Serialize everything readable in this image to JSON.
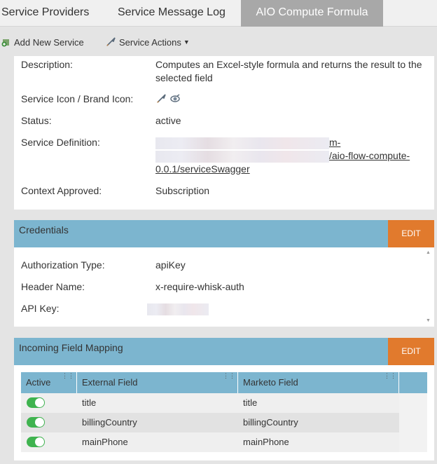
{
  "tabs": [
    {
      "label": "Service Providers",
      "active": false
    },
    {
      "label": "Service Message Log",
      "active": false
    },
    {
      "label": "AIO Compute Formula",
      "active": true
    }
  ],
  "toolbar": {
    "add_label": "Add New Service",
    "actions_label": "Service Actions",
    "add_icon": "add-service-icon",
    "actions_icon": "rocket-icon"
  },
  "details": {
    "description_label": "Description:",
    "description_value": "Computes an Excel-style formula and returns the result to the selected field",
    "icon_label": "Service Icon / Brand Icon:",
    "icons": [
      "rocket-icon",
      "satellite-icon"
    ],
    "status_label": "Status:",
    "status_value": "active",
    "definition_label": "Service Definition:",
    "definition_line1": "m-",
    "definition_line2": "/aio-flow-compute-",
    "definition_line3": "0.0.1/serviceSwagger",
    "context_label": "Context Approved:",
    "context_value": "Subscription"
  },
  "credentials": {
    "title": "Credentials",
    "edit_label": "EDIT",
    "auth_type_label": "Authorization Type:",
    "auth_type_value": "apiKey",
    "header_name_label": "Header Name:",
    "header_name_value": "x-require-whisk-auth",
    "api_key_label": "API Key:"
  },
  "mapping": {
    "title": "Incoming Field Mapping",
    "edit_label": "EDIT",
    "columns": [
      "Active",
      "External Field",
      "Marketo Field"
    ],
    "rows": [
      {
        "active": true,
        "external": "title",
        "marketo": "title"
      },
      {
        "active": true,
        "external": "billingCountry",
        "marketo": "billingCountry"
      },
      {
        "active": true,
        "external": "mainPhone",
        "marketo": "mainPhone"
      }
    ]
  },
  "colors": {
    "section_header": "#7cb5cf",
    "edit_button": "#e17a2d",
    "toggle_on": "#3fb34f",
    "active_tab": "#a8a8a8"
  }
}
